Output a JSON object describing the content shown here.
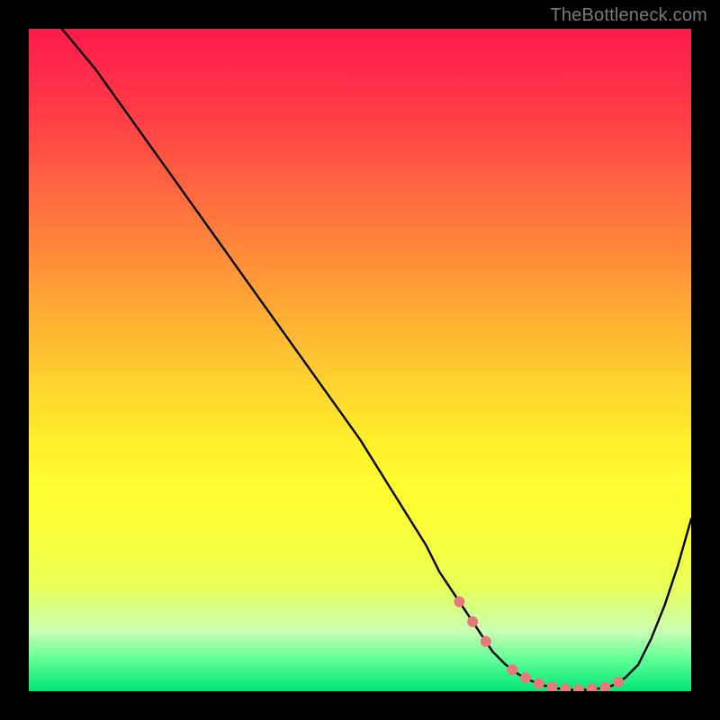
{
  "watermark": {
    "text": "TheBottleneck.com"
  },
  "chart_data": {
    "type": "line",
    "title": "",
    "xlabel": "",
    "ylabel": "",
    "xlim": [
      0,
      100
    ],
    "ylim": [
      0,
      100
    ],
    "grid": false,
    "legend": false,
    "series": [
      {
        "name": "curve",
        "x": [
          5,
          10,
          15,
          20,
          25,
          30,
          35,
          40,
          45,
          50,
          55,
          60,
          62,
          64,
          66,
          68,
          70,
          72,
          74,
          76,
          78,
          80,
          82,
          84,
          86,
          88,
          90,
          92,
          94,
          96,
          98,
          100
        ],
        "y": [
          100,
          94,
          87,
          80,
          73,
          66,
          59,
          52,
          45,
          38,
          30,
          22,
          18,
          15,
          12,
          9,
          6,
          4,
          2.5,
          1.5,
          0.8,
          0.4,
          0.2,
          0.2,
          0.4,
          0.8,
          2,
          4,
          8,
          13,
          19,
          26
        ]
      }
    ],
    "marker_points_x": [
      65,
      67,
      69,
      73,
      75,
      77,
      79,
      81,
      83,
      85,
      87,
      89
    ],
    "colors": {
      "line": "#000000",
      "markers": "#e67a7a",
      "frame": "#000000"
    }
  }
}
